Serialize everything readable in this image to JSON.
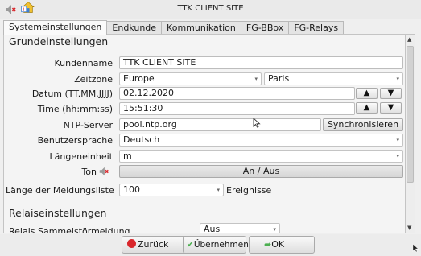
{
  "window": {
    "title": "TTK CLIENT SITE"
  },
  "tabs": [
    {
      "label": "Systemeinstellungen",
      "active": true
    },
    {
      "label": "Endkunde",
      "active": false
    },
    {
      "label": "Kommunikation",
      "active": false
    },
    {
      "label": "FG-BBox",
      "active": false
    },
    {
      "label": "FG-Relays",
      "active": false
    }
  ],
  "grund": {
    "heading": "Grundeinstellungen",
    "kundenname": {
      "label": "Kundenname",
      "value": "TTK CLIENT SITE"
    },
    "zeitzone": {
      "label": "Zeitzone",
      "region": "Europe",
      "city": "Paris"
    },
    "datum": {
      "label": "Datum (TT.MM.JJJJ)",
      "value": "02.12.2020"
    },
    "time": {
      "label": "Time (hh:mm:ss)",
      "value": "15:51:30"
    },
    "ntp": {
      "label": "NTP-Server",
      "value": "pool.ntp.org",
      "sync_button": "Synchronisieren"
    },
    "sprache": {
      "label": "Benutzersprache",
      "value": "Deutsch"
    },
    "laenge": {
      "label": "Längeneinheit",
      "value": "m"
    },
    "ton": {
      "label": "Ton",
      "button": "An / Aus"
    },
    "meldung": {
      "label": "Länge der Meldungsliste",
      "value": "100",
      "suffix": "Ereignisse"
    }
  },
  "relais": {
    "heading": "Relaiseinstellungen",
    "sammel": {
      "label": "Relais Sammelstörmeldung",
      "value": "Aus"
    }
  },
  "buttons": {
    "back": "Zurück",
    "apply": "Übernehmen",
    "ok": "OK"
  },
  "icons": {
    "up": "▲",
    "down": "▼",
    "dropdown": "▾"
  },
  "colors": {
    "cancel_red": "#d9262b",
    "ok_green": "#4caf50"
  }
}
